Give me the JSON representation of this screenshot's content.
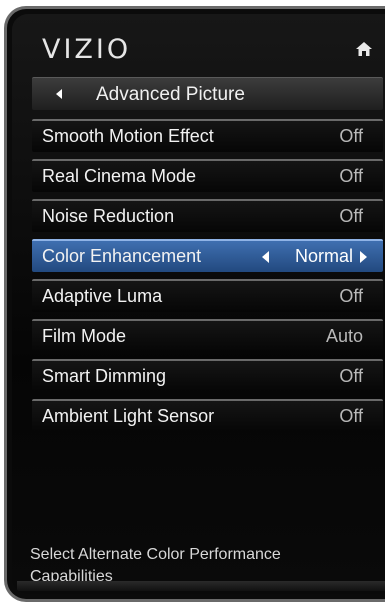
{
  "brand": {
    "logo_text": "VIZIO"
  },
  "header": {
    "home_icon": "home-icon"
  },
  "submenu": {
    "title": "Advanced Picture",
    "back_icon": "back-arrow-icon"
  },
  "menu": {
    "items": [
      {
        "label": "Smooth Motion Effect",
        "value": "Off"
      },
      {
        "label": "Real Cinema Mode",
        "value": "Off"
      },
      {
        "label": "Noise Reduction",
        "value": "Off"
      },
      {
        "label": "Color Enhancement",
        "value": "Normal",
        "selected": true
      },
      {
        "label": "Adaptive Luma",
        "value": "Off"
      },
      {
        "label": "Film Mode",
        "value": "Auto"
      },
      {
        "label": "Smart Dimming",
        "value": "Off"
      },
      {
        "label": "Ambient Light Sensor",
        "value": "Off"
      }
    ]
  },
  "help": {
    "text": "Select Alternate Color Performance Capabilities"
  },
  "colors": {
    "selected_accent": "#2f5f9f",
    "background": "#0b0b0b"
  }
}
